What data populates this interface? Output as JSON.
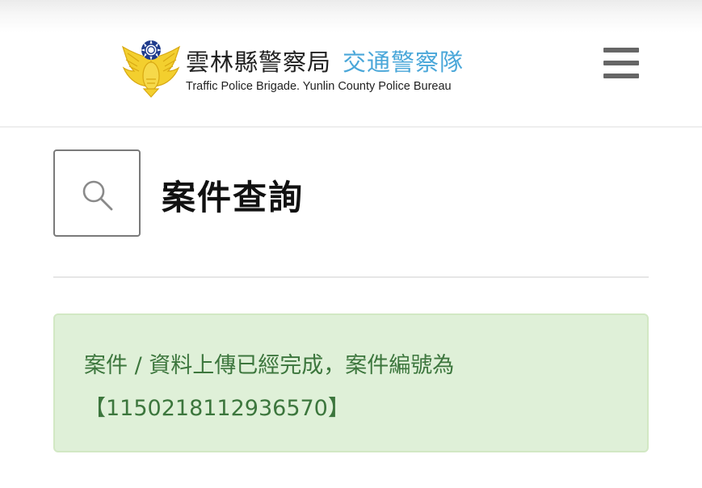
{
  "header": {
    "title_zh_main": "雲林縣警察局",
    "title_zh_sub": "交通警察隊",
    "title_en": "Traffic Police Brigade. Yunlin County Police Bureau",
    "logo_icon": "police-emblem-icon",
    "menu_icon": "hamburger-menu-icon"
  },
  "main": {
    "search_icon": "search-icon",
    "page_title": "案件查詢"
  },
  "alert": {
    "message_line1": "案件 / 資料上傳已經完成，案件編號為",
    "case_number": "【1150218112936570】"
  },
  "colors": {
    "accent_blue": "#4aa7d9",
    "alert_background": "#dff0d8",
    "alert_text": "#3c763d",
    "menu_icon": "#666666"
  }
}
